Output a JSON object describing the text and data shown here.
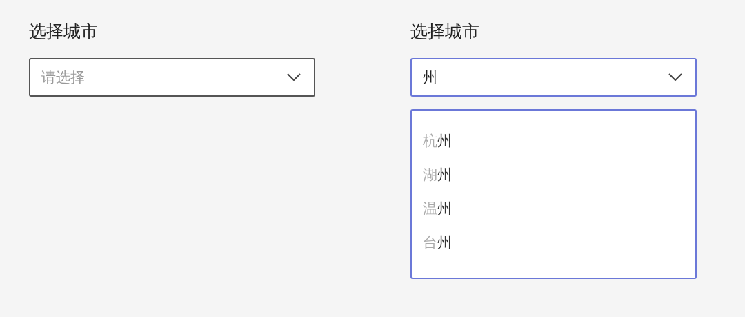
{
  "selects": [
    {
      "label": "选择城市",
      "placeholder": "请选择",
      "focused": false
    },
    {
      "label": "选择城市",
      "value": "州",
      "focused": true,
      "options": [
        {
          "prefix": "杭",
          "match": "州"
        },
        {
          "prefix": "湖",
          "match": "州"
        },
        {
          "prefix": "温",
          "match": "州"
        },
        {
          "prefix": "台",
          "match": "州"
        }
      ]
    }
  ]
}
